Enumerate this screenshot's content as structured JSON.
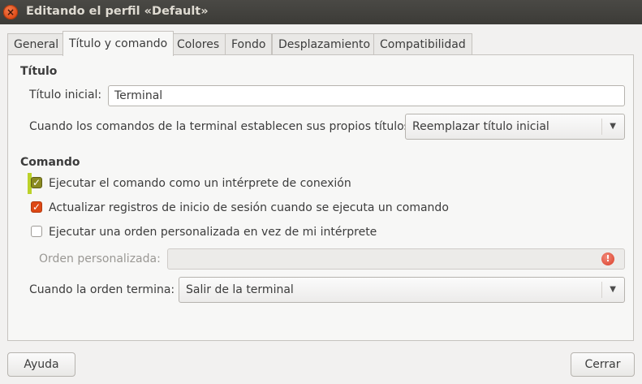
{
  "window": {
    "title": "Editando el perfil «Default»",
    "close_glyph": "×"
  },
  "tabs": [
    {
      "label": "General"
    },
    {
      "label": "Título y comando"
    },
    {
      "label": "Colores"
    },
    {
      "label": "Fondo"
    },
    {
      "label": "Desplazamiento"
    },
    {
      "label": "Compatibilidad"
    }
  ],
  "active_tab": "Título y comando",
  "title_section": {
    "heading": "Título",
    "initial_title_label": "Título inicial:",
    "initial_title_value": "Terminal",
    "dynamic_label": "Cuando los comandos de la terminal establecen sus propios títulos:",
    "dynamic_value": "Reemplazar título inicial"
  },
  "command_section": {
    "heading": "Comando",
    "login_shell": {
      "label": "Ejecutar el comando como un intérprete de conexión",
      "checked": true
    },
    "update_records": {
      "label": "Actualizar registros de inicio de sesión cuando se ejecuta un comando",
      "checked": true
    },
    "custom_command": {
      "label": "Ejecutar una orden personalizada en vez de mi intérprete",
      "checked": false
    },
    "custom_command_label": "Orden personalizada:",
    "custom_command_value": "",
    "on_exit_label": "Cuando la orden  termina:",
    "on_exit_value": "Salir de la terminal"
  },
  "footer": {
    "help_label": "Ayuda",
    "close_label": "Cerrar"
  },
  "colors": {
    "highlight": "#bcd22a",
    "checkbox_accent": "#dd4814",
    "titlebar": "#3c3b37"
  },
  "icons": {
    "window_close": "close-icon",
    "dropdown": "chevron-down-icon",
    "warning": "warning-icon"
  },
  "glyphs": {
    "check": "✓",
    "arrow": "▼",
    "warning": "!"
  }
}
